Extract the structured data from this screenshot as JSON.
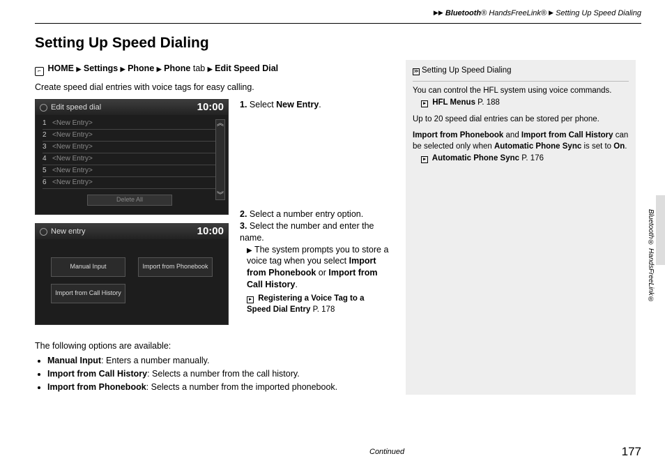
{
  "header": {
    "crumb1": "Bluetooth",
    "reg": "®",
    "crumb2": "HandsFreeLink",
    "crumb3": "Setting Up Speed Dialing"
  },
  "title": "Setting Up Speed Dialing",
  "nav": {
    "home": "HOME",
    "settings": "Settings",
    "phone1": "Phone",
    "phone2": "Phone",
    "tab": "tab",
    "edit": "Edit Speed Dial"
  },
  "intro": "Create speed dial entries with voice tags for easy calling.",
  "shot1": {
    "title": "Edit speed dial",
    "clock": "10:00",
    "entries": [
      {
        "n": "1",
        "label": "<New Entry>"
      },
      {
        "n": "2",
        "label": "<New Entry>"
      },
      {
        "n": "3",
        "label": "<New Entry>"
      },
      {
        "n": "4",
        "label": "<New Entry>"
      },
      {
        "n": "5",
        "label": "<New Entry>"
      },
      {
        "n": "6",
        "label": "<New Entry>"
      }
    ],
    "delete_all": "Delete All"
  },
  "shot2": {
    "title": "New entry",
    "clock": "10:00",
    "btn_manual": "Manual Input",
    "btn_ipb": "Import from Phonebook",
    "btn_ich": "Import from Call History"
  },
  "steps": {
    "s1a": "Select ",
    "s1b": "New Entry",
    "s1c": ".",
    "s2": "Select a number entry option.",
    "s3": "Select the number and enter the name.",
    "s3sub_a": "The system prompts you to store a voice tag when you select ",
    "s3sub_b": "Import from Phonebook",
    "s3sub_c": " or ",
    "s3sub_d": "Import from Call History",
    "s3sub_e": ".",
    "ref_label": "Registering a Voice Tag to a Speed Dial Entry",
    "ref_page": " P. 178"
  },
  "options_h": "The following options are available:",
  "options": [
    {
      "b": "Manual Input",
      "t": ": Enters a number manually."
    },
    {
      "b": "Import from Call History",
      "t": ": Selects a number from the call history."
    },
    {
      "b": "Import from Phonebook",
      "t": ": Selects a number from the imported phonebook."
    }
  ],
  "sidebar": {
    "heading": "Setting Up Speed Dialing",
    "p1": "You can control the HFL system using voice commands.",
    "ref1": "HFL Menus",
    "ref1p": " P. 188",
    "p2": "Up to 20 speed dial entries can be stored per phone.",
    "p3a": "Import from Phonebook",
    "p3b": " and ",
    "p3c": "Import from Call History",
    "p3d": " can be selected only when ",
    "p3e": "Automatic Phone Sync",
    "p3f": " is set to ",
    "p3g": "On",
    "p3h": ".",
    "ref2": "Automatic Phone Sync",
    "ref2p": " P. 176"
  },
  "sidetab": "Bluetooth® HandsFreeLink®",
  "continued": "Continued",
  "page_number": "177"
}
